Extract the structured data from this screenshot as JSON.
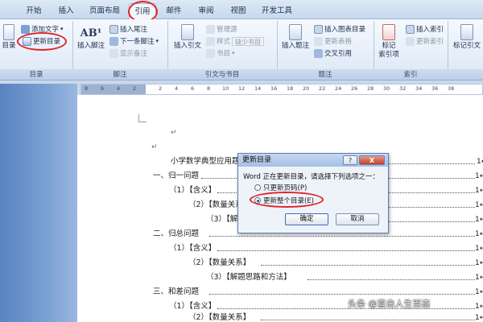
{
  "tabs": [
    "开始",
    "插入",
    "页面布局",
    "引用",
    "邮件",
    "审阅",
    "视图",
    "开发工具"
  ],
  "active_tab": "引用",
  "groups": {
    "toc": {
      "label": "目录",
      "toc_button": "目录",
      "add_text": "添加文字",
      "update_toc": "更新目录"
    },
    "footnotes": {
      "label": "脚注",
      "insert_footnote": "插入脚注",
      "insert_endnote": "插入尾注",
      "next_footnote": "下一条脚注",
      "show_notes": "显示备注"
    },
    "citations": {
      "label": "引文与书目",
      "insert_citation": "插入引文",
      "manage_sources": "管理源",
      "style_label": "样式",
      "style_value": "缺少书目",
      "bibliography": "书目"
    },
    "captions": {
      "label": "题注",
      "insert_caption": "插入题注",
      "insert_table_of_figures": "插入图表目录",
      "update_table": "更新表格",
      "cross_reference": "交叉引用"
    },
    "index": {
      "label": "索引",
      "mark_entry": "标记\n索引项",
      "insert_index": "插入索引",
      "update_index": "更新索引"
    },
    "authorities": {
      "mark_citation": "标记引文"
    }
  },
  "ruler_ticks": [
    "8",
    "6",
    "4",
    "2",
    "2",
    "4",
    "6",
    "8",
    "10",
    "12",
    "14",
    "16",
    "18",
    "20",
    "22",
    "24",
    "26",
    "28",
    "30",
    "32",
    "34",
    "36",
    "38"
  ],
  "document": {
    "para_mark": "↵",
    "title": "小学数学典型应用题",
    "lines": [
      {
        "text": "一、归一问题",
        "page": "1↵"
      },
      {
        "text": "（1）【含义】",
        "page": "1↵"
      },
      {
        "text": "（2）【数量关系】",
        "page": "1↵"
      },
      {
        "text": "（3）【解题思路和方法】",
        "page": "1↵"
      },
      {
        "text": "二、归总问题",
        "page": "1↵"
      },
      {
        "text": "（1）【含义】",
        "page": "1↵"
      },
      {
        "text": "（2）【数量关系】",
        "page": "1↵"
      },
      {
        "text": "（3）【解题思路和方法】",
        "page": "1↵"
      },
      {
        "text": "三、和差问题",
        "page": "1↵"
      },
      {
        "text": "（1）【含义】",
        "page": "1↵"
      },
      {
        "text": "（2）【数量关系】",
        "page": "1↵"
      }
    ]
  },
  "dialog": {
    "title": "更新目录",
    "help": "?",
    "close": "X",
    "message": "Word 正在更新目录，请选择下列选项之一：",
    "option_page_numbers": "只更新页码(P)",
    "option_entire": "更新整个目录(E)",
    "selected": "entire",
    "ok": "确定",
    "cancel": "取消"
  },
  "watermark": "头条 @直击人生百态",
  "colors": {
    "highlight_ring": "#e0262a",
    "ribbon_accent": "#1f4a9a"
  }
}
